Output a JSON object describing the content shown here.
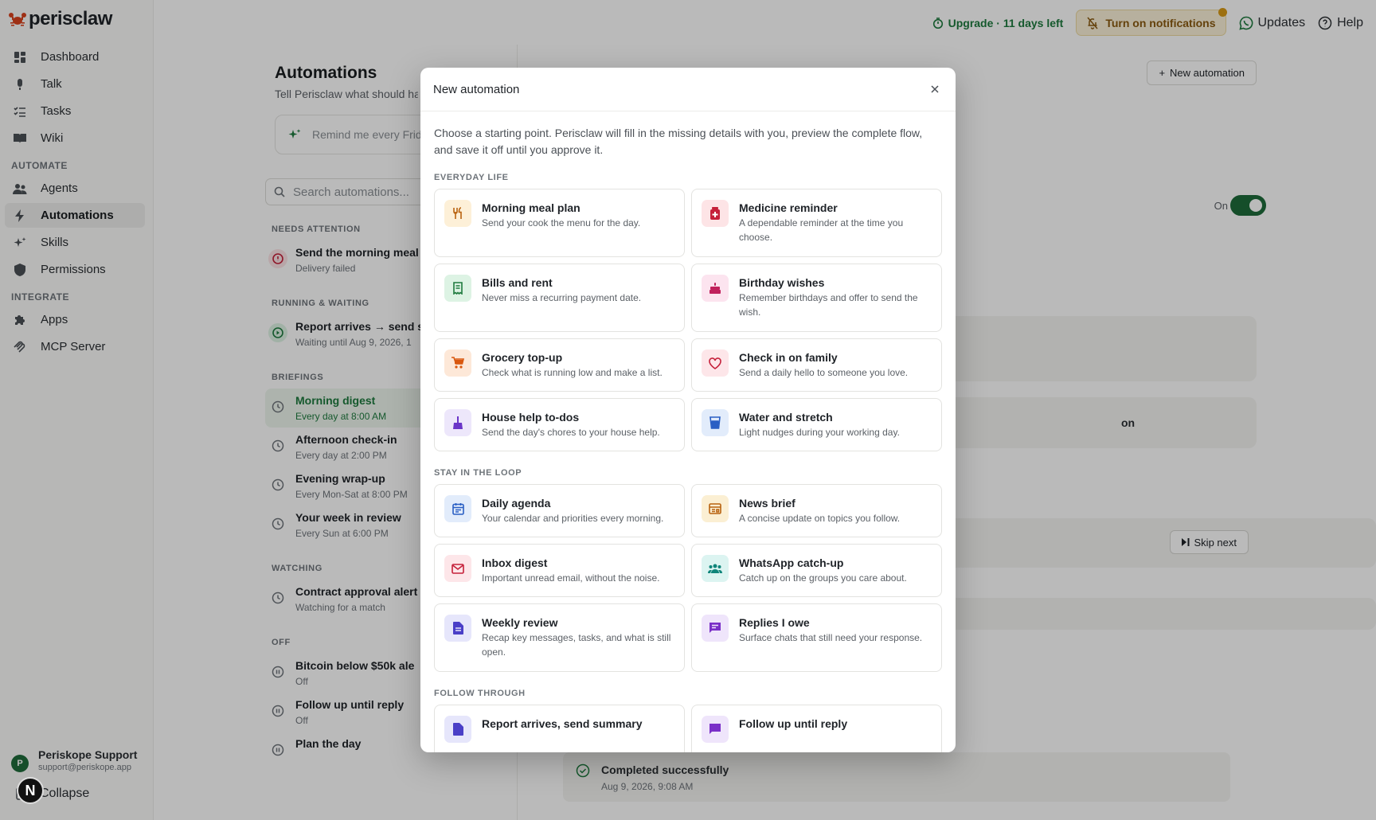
{
  "app": {
    "name": "perisclaw"
  },
  "sidebar": {
    "items_top": [
      {
        "label": "Dashboard",
        "icon": "dashboard-icon"
      },
      {
        "label": "Talk",
        "icon": "microphone-icon"
      },
      {
        "label": "Tasks",
        "icon": "tasks-icon"
      },
      {
        "label": "Wiki",
        "icon": "book-icon"
      }
    ],
    "section_automate": "AUTOMATE",
    "items_automate": [
      {
        "label": "Agents",
        "icon": "agents-icon"
      },
      {
        "label": "Automations",
        "icon": "bolt-icon"
      },
      {
        "label": "Skills",
        "icon": "sparkle-icon"
      },
      {
        "label": "Permissions",
        "icon": "shield-icon"
      }
    ],
    "section_integrate": "INTEGRATE",
    "items_integrate": [
      {
        "label": "Apps",
        "icon": "puzzle-icon"
      },
      {
        "label": "MCP Server",
        "icon": "mcp-icon"
      }
    ],
    "user": {
      "initial": "P",
      "name": "Periskope Support",
      "email": "support@periskope.app"
    },
    "collapse_label": "Collapse",
    "badge": "N"
  },
  "topbar": {
    "upgrade": "Upgrade · 11 days left",
    "notifications": "Turn on notifications",
    "updates": "Updates",
    "help": "Help"
  },
  "page": {
    "title": "Automations",
    "subtitle": "Tell Perisclaw what should ha",
    "prompt_placeholder": "Remind me every Frid",
    "new_automation": "New automation",
    "search_placeholder": "Search automations...",
    "groups": [
      {
        "title": "NEEDS ATTENTION",
        "rows": [
          {
            "title": "Send the morning meal",
            "sub": "Delivery failed",
            "icon": "alert-icon"
          }
        ]
      },
      {
        "title": "RUNNING & WAITING",
        "rows": [
          {
            "title": "Report arrives → send s",
            "sub": "Waiting until Aug 9, 2026, 1",
            "icon": "play-icon"
          }
        ]
      },
      {
        "title": "BRIEFINGS",
        "rows": [
          {
            "title": "Morning digest",
            "sub": "Every day at 8:00 AM",
            "icon": "clock-icon",
            "selected": true
          },
          {
            "title": "Afternoon check-in",
            "sub": "Every day at 2:00 PM",
            "icon": "clock-icon"
          },
          {
            "title": "Evening wrap-up",
            "sub": "Every Mon-Sat at 8:00 PM",
            "icon": "clock-icon"
          },
          {
            "title": "Your week in review",
            "sub": "Every Sun at 6:00 PM",
            "icon": "clock-icon"
          }
        ]
      },
      {
        "title": "WATCHING",
        "rows": [
          {
            "title": "Contract approval alert",
            "sub": "Watching for a match",
            "icon": "clock-icon"
          }
        ]
      },
      {
        "title": "OFF",
        "rows": [
          {
            "title": "Bitcoin below $50k ale",
            "sub": "Off",
            "icon": "pause-icon"
          },
          {
            "title": "Follow up until reply",
            "sub": "Off",
            "icon": "pause-icon"
          },
          {
            "title": "Plan the day",
            "sub": "",
            "icon": "pause-icon"
          }
        ]
      }
    ],
    "detail": {
      "toggle_label": "On",
      "toggle_on": true,
      "partial_text": "on",
      "skip_next": "Skip next",
      "completed_title": "Completed successfully",
      "completed_time": "Aug 9, 2026, 9:08 AM"
    }
  },
  "modal": {
    "title": "New automation",
    "intro": "Choose a starting point. Perisclaw will fill in the missing details with you, preview the complete flow, and save it off until you approve it.",
    "sections": [
      {
        "title": "EVERYDAY LIFE",
        "templates": [
          {
            "title": "Morning meal plan",
            "desc": "Send your cook the menu for the day.",
            "icon": "utensils-icon",
            "color": "c-amber"
          },
          {
            "title": "Medicine reminder",
            "desc": "A dependable reminder at the time you choose.",
            "icon": "medicine-icon",
            "color": "c-red"
          },
          {
            "title": "Bills and rent",
            "desc": "Never miss a recurring payment date.",
            "icon": "receipt-icon",
            "color": "c-green"
          },
          {
            "title": "Birthday wishes",
            "desc": "Remember birthdays and offer to send the wish.",
            "icon": "cake-icon",
            "color": "c-pink"
          },
          {
            "title": "Grocery top-up",
            "desc": "Check what is running low and make a list.",
            "icon": "cart-icon",
            "color": "c-orange"
          },
          {
            "title": "Check in on family",
            "desc": "Send a daily hello to someone you love.",
            "icon": "heart-icon",
            "color": "c-rose"
          },
          {
            "title": "House help to-dos",
            "desc": "Send the day's chores to your house help.",
            "icon": "broom-icon",
            "color": "c-purple"
          },
          {
            "title": "Water and stretch",
            "desc": "Light nudges during your working day.",
            "icon": "water-glass-icon",
            "color": "c-blue"
          }
        ]
      },
      {
        "title": "STAY IN THE LOOP",
        "templates": [
          {
            "title": "Daily agenda",
            "desc": "Your calendar and priorities every morning.",
            "icon": "calendar-icon",
            "color": "c-blue"
          },
          {
            "title": "News brief",
            "desc": "A concise update on topics you follow.",
            "icon": "newspaper-icon",
            "color": "c-yellow"
          },
          {
            "title": "Inbox digest",
            "desc": "Important unread email, without the noise.",
            "icon": "mail-icon",
            "color": "c-rose"
          },
          {
            "title": "WhatsApp catch-up",
            "desc": "Catch up on the groups you care about.",
            "icon": "groups-icon",
            "color": "c-teal"
          },
          {
            "title": "Weekly review",
            "desc": "Recap key messages, tasks, and what is still open.",
            "icon": "document-icon",
            "color": "c-indigo"
          },
          {
            "title": "Replies I owe",
            "desc": "Surface chats that still need your response.",
            "icon": "chat-icon",
            "color": "c-violet"
          }
        ]
      },
      {
        "title": "FOLLOW THROUGH",
        "templates": [
          {
            "title": "Report arrives, send summary",
            "desc": "",
            "icon": "document-icon",
            "color": "c-indigo"
          },
          {
            "title": "Follow up until reply",
            "desc": "",
            "icon": "chat-icon",
            "color": "c-violet"
          }
        ]
      }
    ]
  },
  "colors": {
    "brand": "#d9431e",
    "accent_green": "#1e7a3e",
    "toggle_on": "#1e6b3a"
  }
}
